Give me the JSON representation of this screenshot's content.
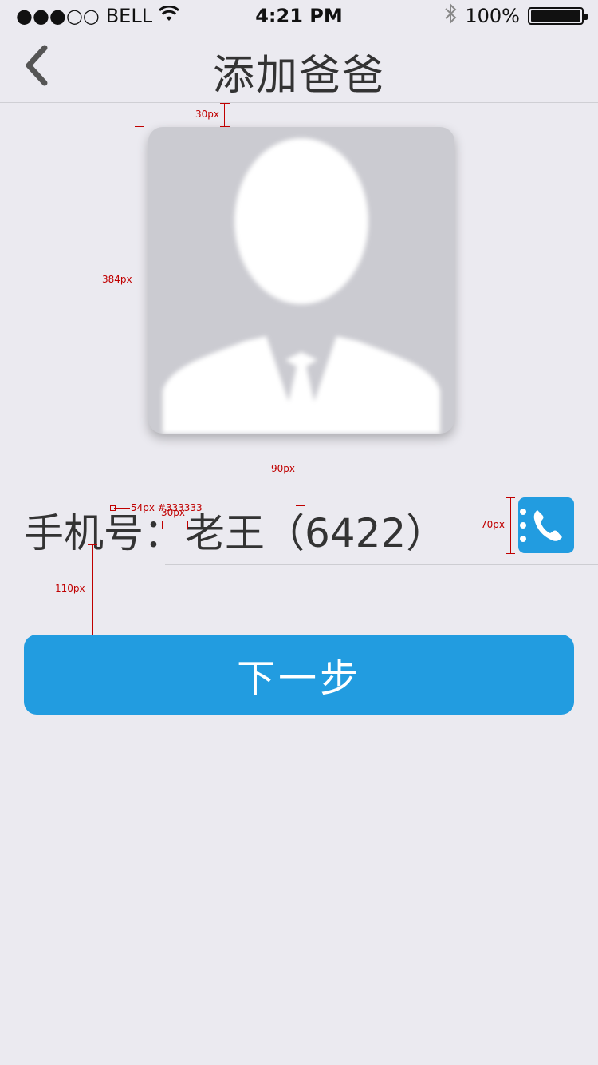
{
  "status_bar": {
    "carrier": "BELL",
    "signal": "●●●○○",
    "time": "4:21 PM",
    "battery_percent": "100%",
    "battery_level": 1.0
  },
  "nav": {
    "title": "添加爸爸",
    "back_icon": "chevron-left-icon"
  },
  "avatar": {
    "icon": "person-silhouette-icon"
  },
  "phone_row": {
    "label": "手机号：",
    "value": "老王（6422）",
    "contact_icon": "phone-book-icon"
  },
  "next_button": {
    "label": "下一步"
  },
  "annotations": {
    "top_gap": "30px",
    "avatar_size": "384px",
    "avatar_gap": "90px",
    "font_spec": "54px #333333",
    "colon_gap": "30px",
    "icon_size": "70px",
    "button_gap": "110px"
  },
  "colors": {
    "accent": "#229ce0",
    "text": "#333333",
    "background": "#ebeaf0",
    "annotation": "#c00000"
  }
}
